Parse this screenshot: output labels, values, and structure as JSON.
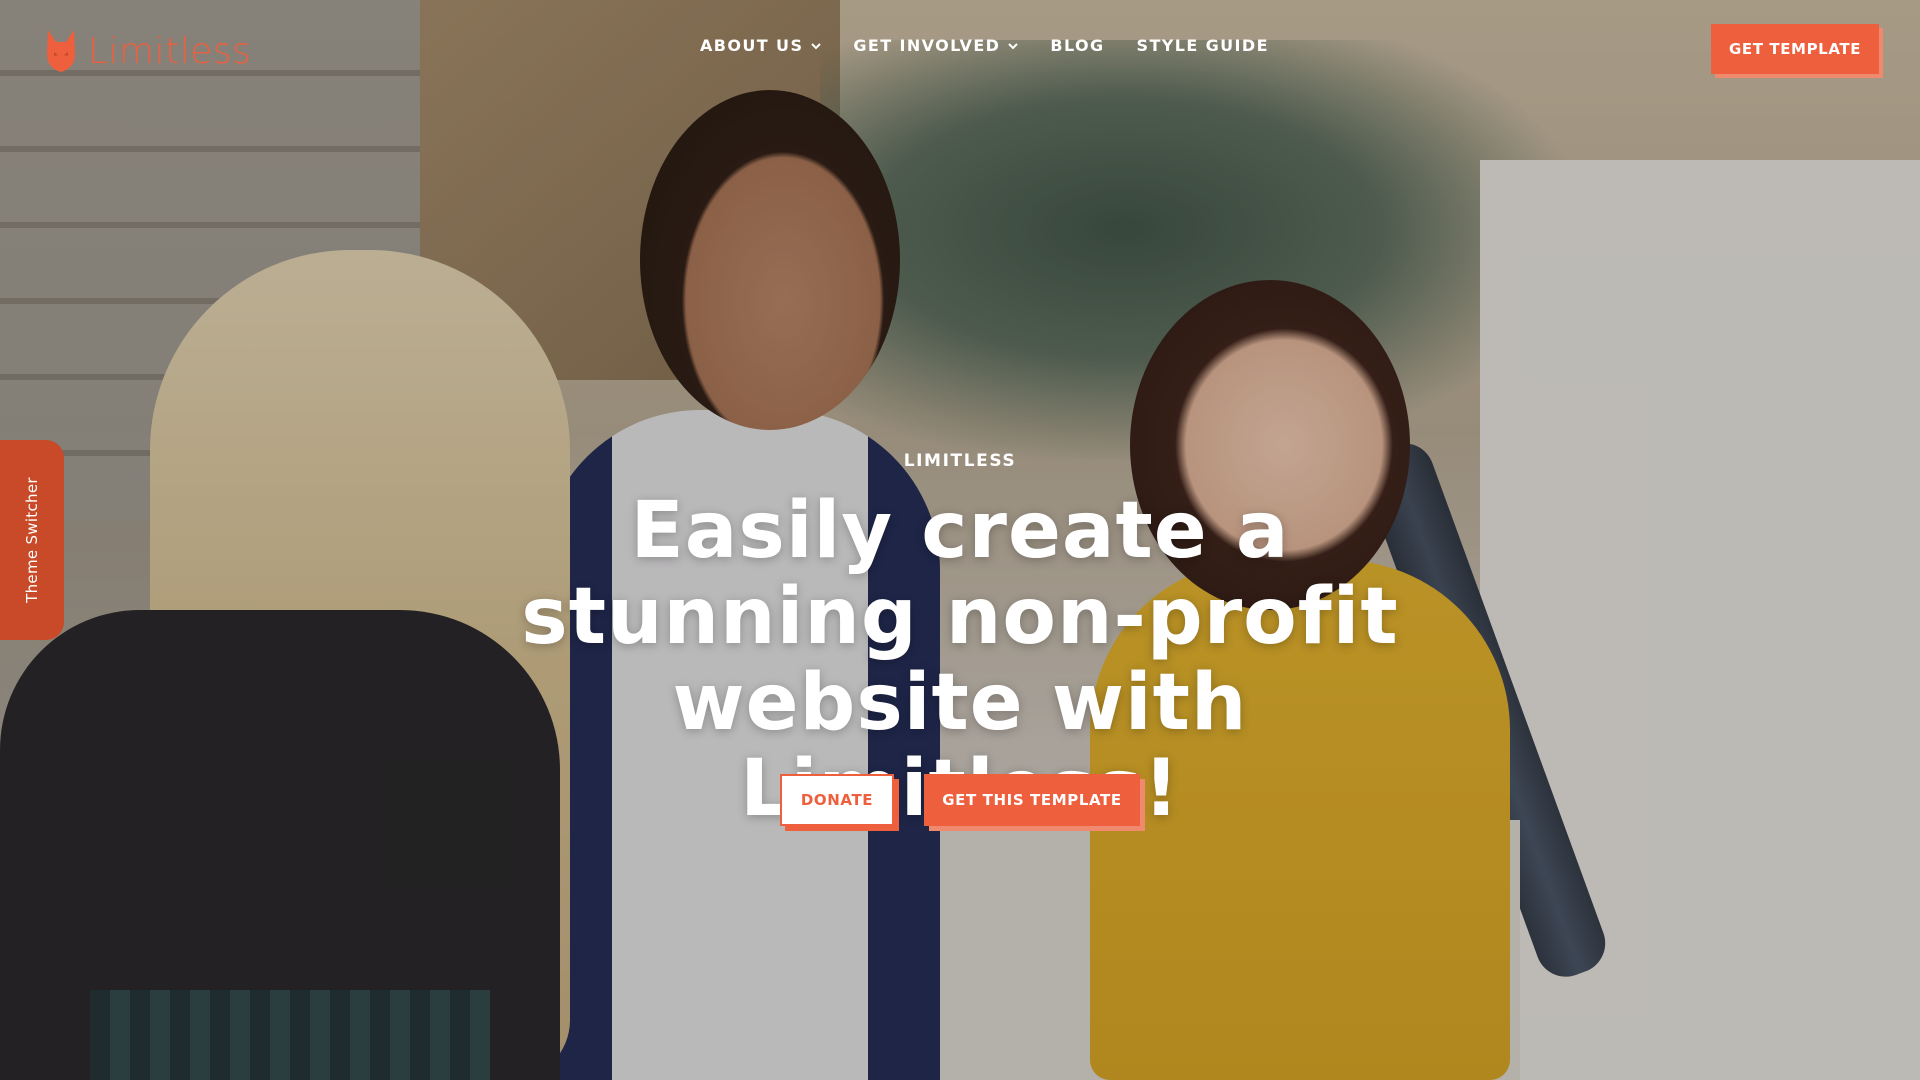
{
  "brand": {
    "name": "Limitless",
    "logo_icon": "fox-icon",
    "accent_color": "#ee5f3d"
  },
  "nav": {
    "items": [
      {
        "label": "ABOUT US",
        "has_dropdown": true
      },
      {
        "label": "GET INVOLVED",
        "has_dropdown": true
      },
      {
        "label": "BLOG",
        "has_dropdown": false
      },
      {
        "label": "STYLE GUIDE",
        "has_dropdown": false
      }
    ]
  },
  "header": {
    "cta_label": "GET TEMPLATE"
  },
  "theme_switcher": {
    "label": "Theme Switcher"
  },
  "hero": {
    "eyebrow": "LIMITLESS",
    "headline": "Easily create a stunning non-profit website with Limitless!",
    "primary_button": "DONATE",
    "secondary_button": "GET THIS TEMPLATE"
  }
}
